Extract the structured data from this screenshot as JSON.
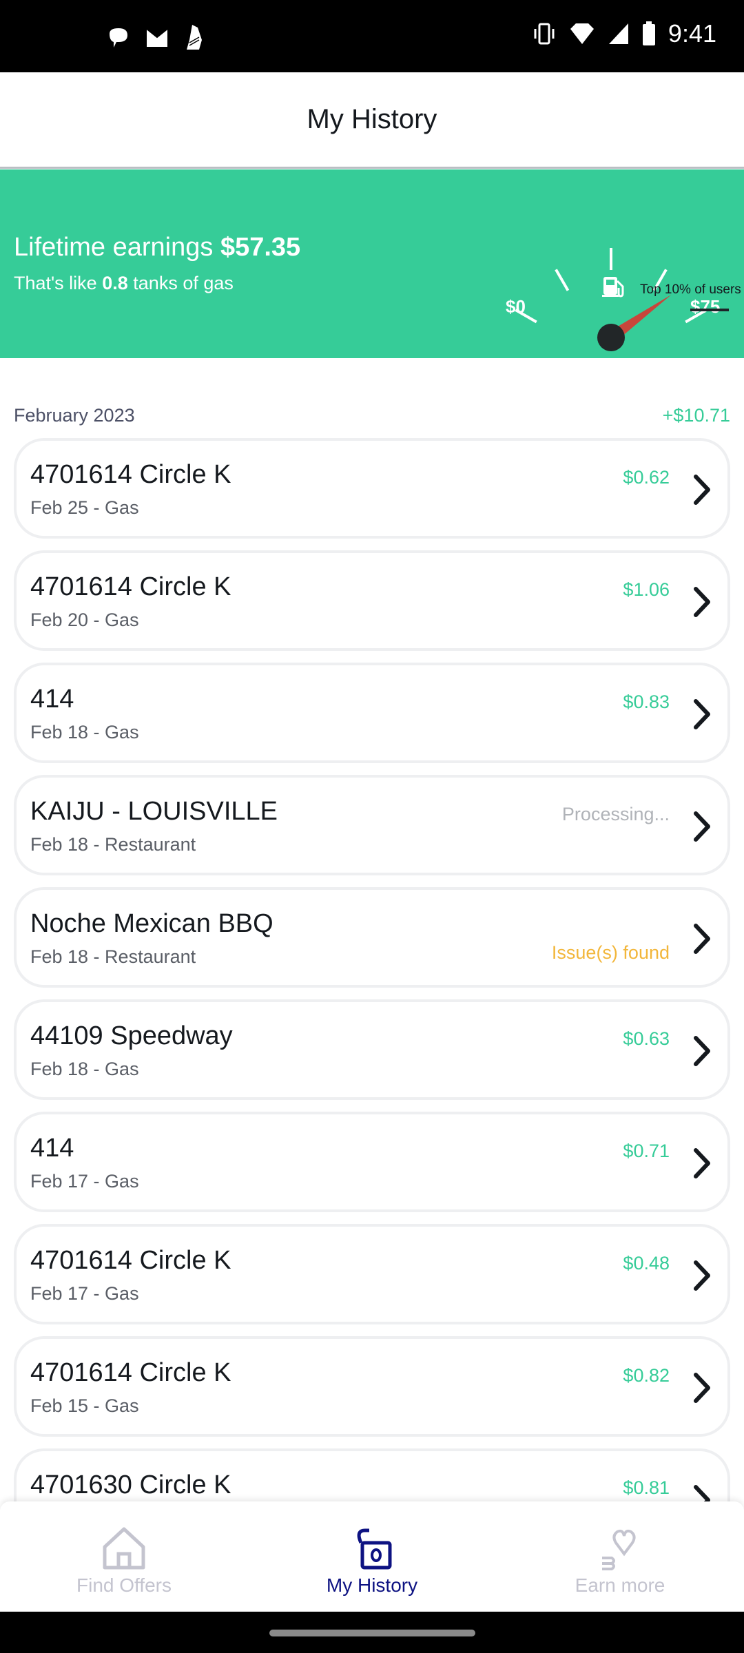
{
  "status_bar": {
    "time": "9:41",
    "left_icons": [
      "chat-bubble-icon",
      "gmail-icon",
      "shoe-icon"
    ],
    "right_icons": [
      "vibrate-icon",
      "wifi-icon",
      "cell-signal-icon",
      "battery-icon"
    ]
  },
  "header": {
    "title": "My History"
  },
  "earnings": {
    "label": "Lifetime earnings",
    "amount": "$57.35",
    "subline_prefix": "That's like",
    "tanks": "0.8",
    "subline_suffix": "tanks of gas",
    "accent_color": "#36cc98"
  },
  "gauge": {
    "min_label": "$0",
    "max_label": "$75",
    "caption": "Top 10% of users",
    "value_fraction": 0.76,
    "needle_color": "#c8463b"
  },
  "section": {
    "month": "February 2023",
    "total": "+$10.71"
  },
  "transactions": [
    {
      "merchant": "4701614 Circle K",
      "meta": "Feb 25 - Gas",
      "status": "$0.62",
      "status_type": "amount"
    },
    {
      "merchant": "4701614 Circle K",
      "meta": "Feb 20 - Gas",
      "status": "$1.06",
      "status_type": "amount"
    },
    {
      "merchant": "414",
      "meta": "Feb 18 - Gas",
      "status": "$0.83",
      "status_type": "amount"
    },
    {
      "merchant": "KAIJU - LOUISVILLE",
      "meta": "Feb 18 - Restaurant",
      "status": "Processing...",
      "status_type": "processing"
    },
    {
      "merchant": "Noche Mexican BBQ",
      "meta": "Feb 18 - Restaurant",
      "status": "Issue(s) found",
      "status_type": "issue"
    },
    {
      "merchant": "44109 Speedway",
      "meta": "Feb 18 - Gas",
      "status": "$0.63",
      "status_type": "amount"
    },
    {
      "merchant": "414",
      "meta": "Feb 17 - Gas",
      "status": "$0.71",
      "status_type": "amount"
    },
    {
      "merchant": "4701614 Circle K",
      "meta": "Feb 17 - Gas",
      "status": "$0.48",
      "status_type": "amount"
    },
    {
      "merchant": "4701614 Circle K",
      "meta": "Feb 15 - Gas",
      "status": "$0.82",
      "status_type": "amount"
    },
    {
      "merchant": "4701630 Circle K",
      "meta": "",
      "status": "$0.81",
      "status_type": "amount"
    }
  ],
  "bottom_nav": {
    "items": [
      {
        "label": "Find Offers",
        "icon": "home-icon",
        "active": false
      },
      {
        "label": "My History",
        "icon": "wallet-history-icon",
        "active": true
      },
      {
        "label": "Earn more",
        "icon": "heart-hand-icon",
        "active": false
      }
    ]
  }
}
